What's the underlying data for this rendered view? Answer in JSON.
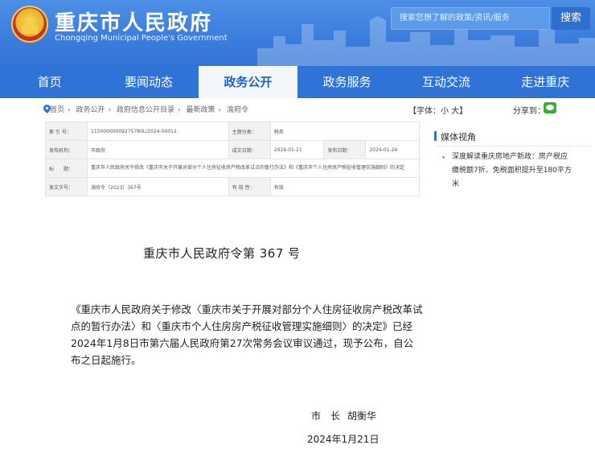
{
  "header": {
    "title": "重庆市人民政府",
    "subtitle": "Chongqing Municipal People's Government",
    "search_placeholder": "搜索您想了解的政策/资讯/服务",
    "search_button": "搜索"
  },
  "nav": {
    "items": [
      "首页",
      "要闻动态",
      "政务公开",
      "政务服务",
      "互动交流",
      "走进重庆"
    ],
    "active_index": 2
  },
  "breadcrumb": [
    "首页",
    "政务公开",
    "政府信息公开目录",
    "最新政策",
    "渝府令"
  ],
  "font_size": {
    "label": "【字体：",
    "small": "小",
    "large": "大",
    "close": "】"
  },
  "share": {
    "label": "分享到："
  },
  "info_table": {
    "index_key": "索 引 号：",
    "index_val": "11500000009275780L/2024-00012",
    "topic_key": "主题分类：",
    "topic_val": "税务",
    "issuer_key": "发布机构：",
    "issuer_val": "市政府",
    "written_key": "成文日期：",
    "written_val": "2024-01-21",
    "published_key": "发布日期：",
    "published_val": "2024-01-24",
    "subject_key": "标　　题：",
    "subject_val": "重庆市人民政府关于修改《重庆市关于开展对部分个人住房征收房产税改革试点的暂行办法》和《重庆市个人住房房产税征收管理实施细则》的决定",
    "docno_key": "发文字号：",
    "docno_val": "渝府令〔2023〕367号",
    "validity_key": "有 效 性：",
    "validity_val": "有效"
  },
  "sidebar": {
    "title": "媒体视角",
    "items": [
      "深度解读重庆房地产新政：房产税应缴税额7折、免税面积提升至180平方米"
    ]
  },
  "document": {
    "title": "重庆市人民政府令第  367  号",
    "body": "《重庆市人民政府关于修改〈重庆市关于开展对部分个人住房征收房产税改革试点的暂行办法〉和〈重庆市个人住房房产税征收管理实施细则〉的决定》已经2024年1月8日市第六届人民政府第27次常务会议审议通过，现予公布，自公布之日起施行。",
    "signer_role": "市　长",
    "signer_name": "胡衡华",
    "date": "2024年1月21日"
  },
  "colors": {
    "header_blue": "#3a7ddd",
    "nav_blue": "#2f73d6",
    "active_tab_bg": "#f3f6fb",
    "active_tab_text": "#1f64c8",
    "wechat_green": "#35b035"
  }
}
